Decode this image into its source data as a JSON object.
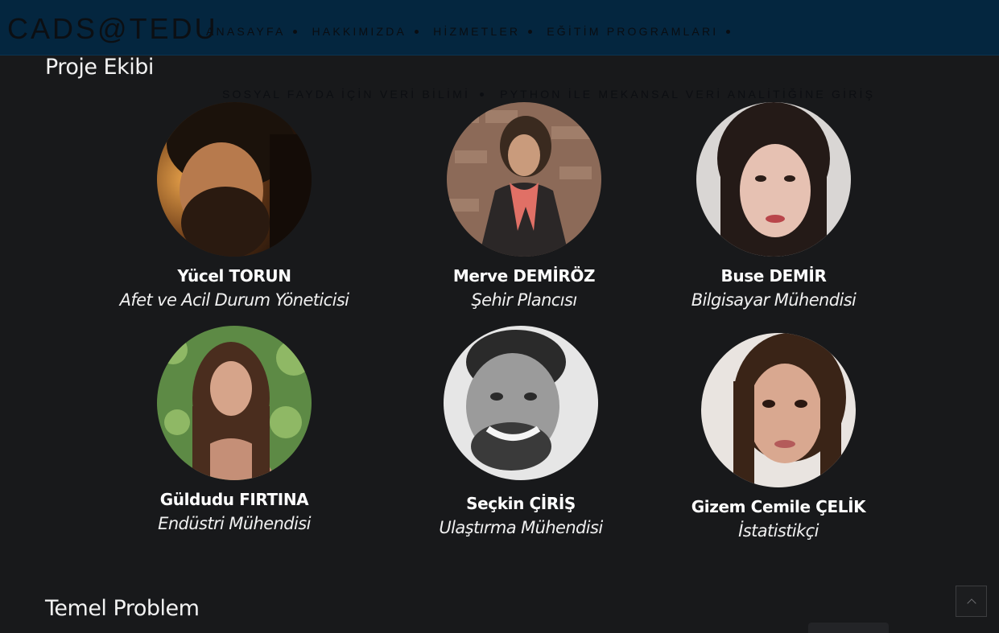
{
  "header": {
    "brand": "CADS@TEDU",
    "nav": [
      "ANASAYFA",
      "HAKKIMIZDA",
      "HİZMETLER",
      "EĞİTİM PROGRAMLARI"
    ],
    "subnav": [
      "SOSYAL FAYDA İÇİN VERİ BİLİMİ",
      "PYTHON İLE MEKANSAL VERİ ANALİTİĞİNE GİRİŞ"
    ]
  },
  "team": {
    "title": "Proje Ekibi",
    "members": [
      {
        "name": "Yücel TORUN",
        "role": "Afet ve Acil Durum Yöneticisi"
      },
      {
        "name": "Merve DEMİRÖZ",
        "role": "Şehir Plancısı"
      },
      {
        "name": "Buse DEMİR",
        "role": "Bilgisayar Mühendisi"
      },
      {
        "name": "Güldudu FIRTINA",
        "role": "Endüstri Mühendisi"
      },
      {
        "name": "Seçkin ÇİRİŞ",
        "role": "Ulaştırma Mühendisi"
      },
      {
        "name": "Gizem Cemile ÇELİK",
        "role": "İstatistikçi"
      }
    ]
  },
  "problem": {
    "title": "Temel Problem"
  },
  "colors": {
    "header_bg": "#04263f",
    "page_bg": "#18191b",
    "text": "#ffffff"
  },
  "icons": {
    "scroll_top": "chevron-up-icon"
  }
}
